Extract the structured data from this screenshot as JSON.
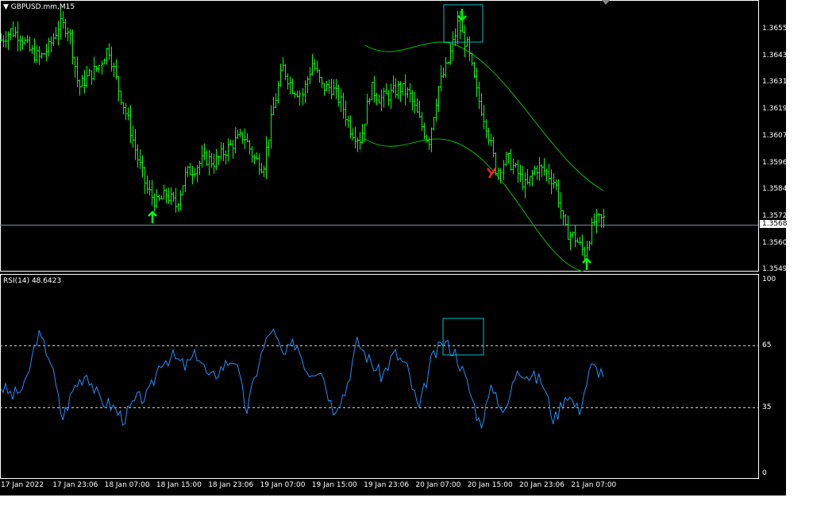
{
  "main": {
    "title": "GBPUSD.mm,M15",
    "current_price": "1.3568",
    "price_ticks": [
      "1.3655",
      "1.3643",
      "1.3631",
      "1.3619",
      "1.3607",
      "1.3596",
      "1.3584",
      "1.3572",
      "1.3560",
      "1.3549"
    ]
  },
  "rsi": {
    "title": "RSI(14) 48.6423",
    "ticks": [
      "100",
      "65",
      "35",
      "0"
    ]
  },
  "time_ticks": [
    "17 Jan 2022",
    "17 Jan 23:06",
    "18 Jan 07:00",
    "18 Jan 15:00",
    "18 Jan 23:06",
    "19 Jan 07:00",
    "19 Jan 15:00",
    "19 Jan 23:06",
    "20 Jan 07:00",
    "20 Jan 15:00",
    "20 Jan 23:06",
    "21 Jan 07:00"
  ],
  "colors": {
    "bars": "#00ff00",
    "rsi": "#1e90ff",
    "envelope": "#00c000",
    "box": "#00c0c0",
    "sell": "#ff2020"
  },
  "chart_data": {
    "type": "bar",
    "symbol": "GBPUSD.mm",
    "timeframe": "M15",
    "ylim": [
      1.3549,
      1.366
    ],
    "price_keypoints": [
      1.365,
      1.3654,
      1.3652,
      1.3645,
      1.3642,
      1.3647,
      1.3657,
      1.3655,
      1.3629,
      1.3634,
      1.3638,
      1.3647,
      1.3629,
      1.3615,
      1.3598,
      1.3584,
      1.3578,
      1.3582,
      1.3577,
      1.3591,
      1.3594,
      1.3598,
      1.3596,
      1.3601,
      1.3605,
      1.3608,
      1.3598,
      1.3594,
      1.3619,
      1.3638,
      1.3629,
      1.3626,
      1.364,
      1.3629,
      1.3629,
      1.3622,
      1.361,
      1.3606,
      1.3629,
      1.3624,
      1.3626,
      1.3629,
      1.3626,
      1.3615,
      1.3605,
      1.3629,
      1.364,
      1.3657,
      1.3647,
      1.3626,
      1.3612,
      1.3592,
      1.3598,
      1.3592,
      1.3585,
      1.3594,
      1.3592,
      1.3587,
      1.3566,
      1.3563,
      1.3556,
      1.357,
      1.3571
    ],
    "rsi_keypoints": [
      45,
      40,
      45,
      72,
      60,
      28,
      45,
      52,
      38,
      35,
      28,
      38,
      40,
      58,
      60,
      55,
      62,
      48,
      55,
      60,
      32,
      58,
      75,
      60,
      68,
      52,
      55,
      33,
      42,
      68,
      58,
      50,
      62,
      55,
      32,
      58,
      68,
      62,
      45,
      25,
      45,
      30,
      55,
      50,
      48,
      27,
      42,
      32,
      55,
      52
    ],
    "rsi_levels": [
      65,
      35
    ],
    "rsi_last": 48.6423
  }
}
